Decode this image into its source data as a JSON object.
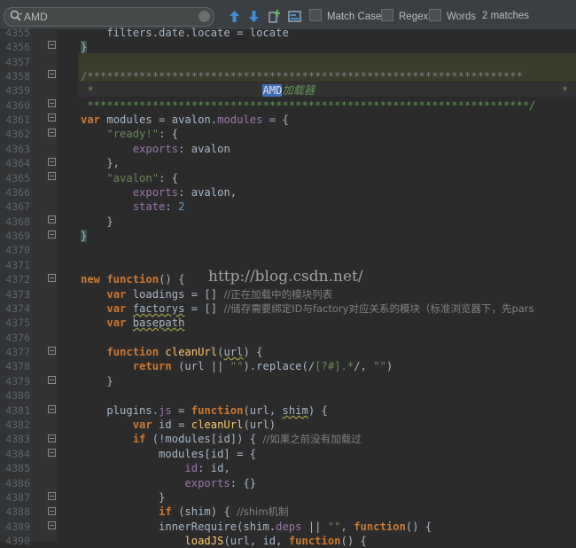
{
  "search": {
    "value": "AMD",
    "match_case_label": "Match Case",
    "regex_label": "Regex",
    "words_label": "Words",
    "matches_text": "2 matches"
  },
  "colors": {
    "background": "#2b2b2b",
    "gutter": "#313335",
    "keyword": "#cc7832",
    "string": "#6a8759",
    "number": "#6897bb",
    "property": "#9876aa",
    "function": "#ffc66d",
    "comment": "#808080",
    "match": "#3f6fb8"
  },
  "watermark": "http://blog.csdn.net/",
  "line_numbers": [
    "4355",
    "4356",
    "4357",
    "4358",
    "4359",
    "4360",
    "4361",
    "4362",
    "4363",
    "4364",
    "4365",
    "4366",
    "4367",
    "4368",
    "4369",
    "4370",
    "4371",
    "4372",
    "4373",
    "4374",
    "4375",
    "4376",
    "4377",
    "4378",
    "4379",
    "4380",
    "4381",
    "4382",
    "4383",
    "4384",
    "4385",
    "4386",
    "4387",
    "4388",
    "4389",
    "4390"
  ],
  "code": {
    "l4355": "    filters.date.locate = locate",
    "l4356": "}",
    "l4358": "/*******************************************************************",
    "l4359_pre": " *                          ",
    "l4359_match": "AMD",
    "l4359_post": "加载器                                      *",
    "l4360": " ********************************************************************/",
    "l4361_a": "var",
    "l4361_b": " modules = ",
    "l4361_c": "avalon",
    "l4361_d": ".",
    "l4361_e": "modules",
    "l4361_f": " = {",
    "l4362_s": "\"ready!\"",
    "l4362_r": ": {",
    "l4363_p": "exports",
    "l4363_r": ": avalon",
    "l4364": "    },",
    "l4365_s": "\"avalon\"",
    "l4365_r": ": {",
    "l4366_p": "exports",
    "l4366_r": ": avalon,",
    "l4367_p": "state",
    "l4367_r": ": ",
    "l4367_n": "2",
    "l4368": "    }",
    "l4369": "}",
    "l4372_k": "new function",
    "l4372_r": "() {",
    "l4373_k": "var",
    "l4373_r": " loadings = [] ",
    "l4373_c": "//正在加载中的模块列表",
    "l4374_k": "var",
    "l4374_v": "factorys",
    "l4374_r": " = [] ",
    "l4374_c": "//储存需要绑定ID与factory对应关系的模块（标准浏览器下，先pars",
    "l4375_k": "var",
    "l4375_v": "basepath",
    "l4377_k": "function",
    "l4377_f": "cleanUrl",
    "l4377_p": "url",
    "l4377_r": ") {",
    "l4378_k": "return",
    "l4378_a": " (url || ",
    "l4378_s": "\"\"",
    "l4378_b": ").replace(/",
    "l4378_re": "[?#].*",
    "l4378_c": "/, ",
    "l4378_s2": "\"\"",
    "l4378_d": ")",
    "l4379": "    }",
    "l4381_a": "    plugins.",
    "l4381_p": "js",
    "l4381_b": " = ",
    "l4381_k": "function",
    "l4381_c": "(url, ",
    "l4381_u": "shim",
    "l4381_d": ") {",
    "l4382_k": "var",
    "l4382_a": " id = ",
    "l4382_f": "cleanUrl",
    "l4382_b": "(url)",
    "l4383_k": "if",
    "l4383_a": " (!modules[id]) { ",
    "l4383_c": "//如果之前没有加载过",
    "l4384": "            modules[id] = {",
    "l4385_p": "id",
    "l4385_r": ": id,",
    "l4386_p": "exports",
    "l4386_r": ": {}",
    "l4387": "            }",
    "l4388_k": "if",
    "l4388_a": " (shim) { ",
    "l4388_c": "//shim机制",
    "l4389_a": "            innerRequire(shim.",
    "l4389_p": "deps",
    "l4389_b": " || ",
    "l4389_s": "\"\"",
    "l4389_c": ", ",
    "l4389_k": "function",
    "l4389_d": "() {",
    "l4390_f": "loadJS",
    "l4390_a": "(url, id, ",
    "l4390_k": "function",
    "l4390_b": "() {"
  }
}
